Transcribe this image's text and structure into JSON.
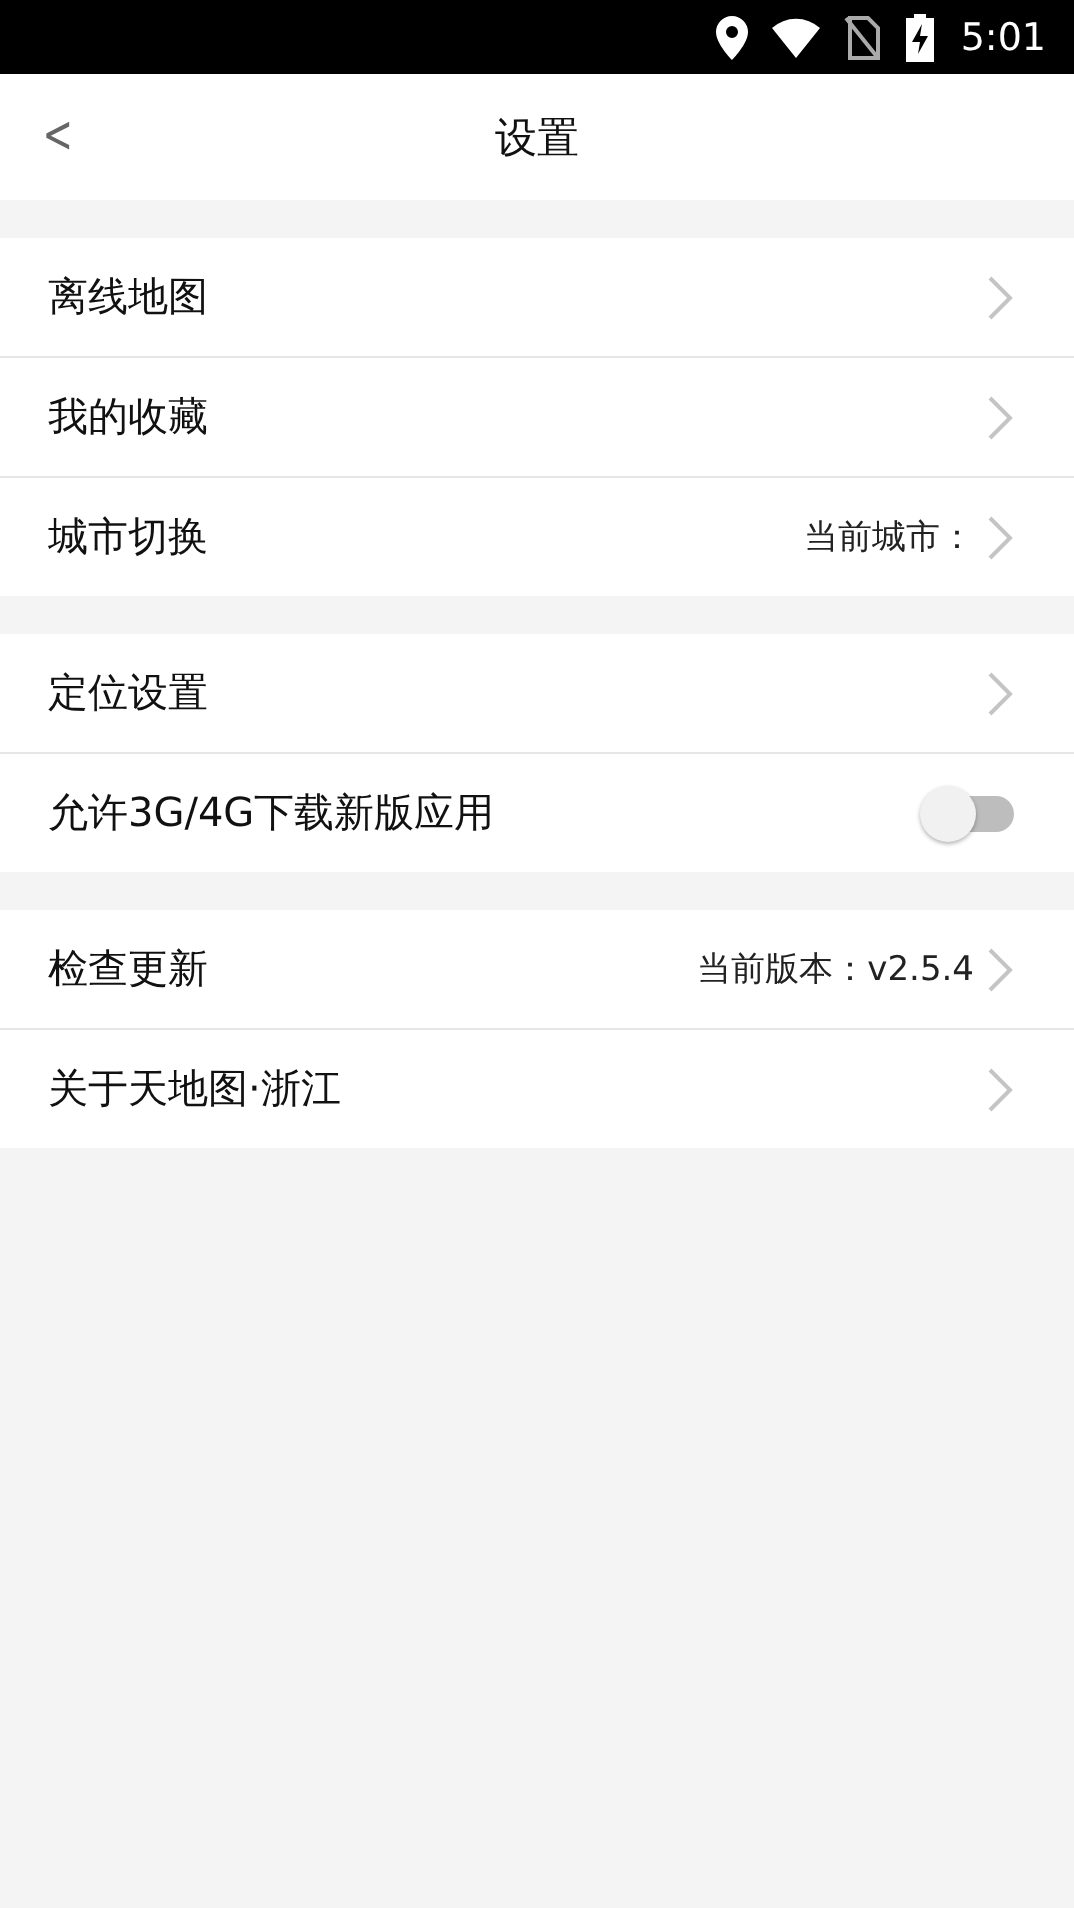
{
  "status_bar": {
    "time": "5:01"
  },
  "header": {
    "back": "<",
    "title": "设置"
  },
  "groups": [
    {
      "rows": [
        {
          "kind": "link",
          "label": "离线地图"
        },
        {
          "kind": "link",
          "label": "我的收藏"
        },
        {
          "kind": "link",
          "label": "城市切换",
          "value": "当前城市："
        }
      ]
    },
    {
      "rows": [
        {
          "kind": "link",
          "label": "定位设置"
        },
        {
          "kind": "toggle",
          "label": "允许3G/4G下载新版应用",
          "on": false
        }
      ]
    },
    {
      "rows": [
        {
          "kind": "link",
          "label": "检查更新",
          "value": "当前版本：v2.5.4"
        },
        {
          "kind": "link",
          "label": "关于天地图·浙江"
        }
      ]
    }
  ]
}
